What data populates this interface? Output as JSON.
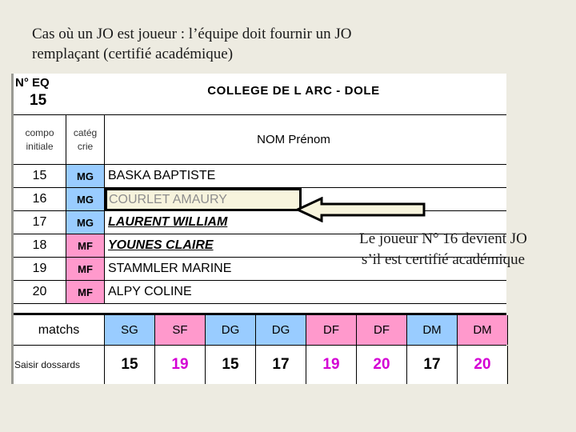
{
  "caption": {
    "line1": "Cas où un JO est joueur : l’équipe doit fournir un JO",
    "line2": "remplaçant (certifié académique)"
  },
  "sheet": {
    "eq_label": "N° EQ",
    "eq_value": "15",
    "school_name": "COLLEGE DE L ARC - DOLE",
    "subheaders": {
      "compo_l1": "compo",
      "compo_l2": "initiale",
      "categ_l1": "catég",
      "categ_l2": "crie",
      "name": "NOM Prénom"
    },
    "players": [
      {
        "num": "15",
        "categ": "MG",
        "name": "BASKA BAPTISTE",
        "style": "plain",
        "boxed": false
      },
      {
        "num": "16",
        "categ": "MG",
        "name": "COURLET AMAURY",
        "style": "faded",
        "boxed": true
      },
      {
        "num": "17",
        "categ": "MG",
        "name": "LAURENT WILLIAM",
        "style": "emph",
        "boxed": false
      },
      {
        "num": "18",
        "categ": "MF",
        "name": "YOUNES CLAIRE",
        "style": "emph",
        "boxed": false
      },
      {
        "num": "19",
        "categ": "MF",
        "name": "STAMMLER MARINE",
        "style": "plain",
        "boxed": false
      },
      {
        "num": "20",
        "categ": "MF",
        "name": "ALPY COLINE",
        "style": "plain",
        "boxed": false
      }
    ],
    "matches": {
      "row_label": "matchs",
      "dossards_label": "Saisir dossards",
      "columns": [
        {
          "type": "SG",
          "color": "blue",
          "dossard": "15",
          "dossard_color": "black"
        },
        {
          "type": "SF",
          "color": "pink",
          "dossard": "19",
          "dossard_color": "magenta"
        },
        {
          "type": "DG",
          "color": "blue",
          "dossard": "15",
          "dossard_color": "black"
        },
        {
          "type": "DG",
          "color": "blue",
          "dossard": "17",
          "dossard_color": "black"
        },
        {
          "type": "DF",
          "color": "pink",
          "dossard": "19",
          "dossard_color": "magenta"
        },
        {
          "type": "DF",
          "color": "pink",
          "dossard": "20",
          "dossard_color": "magenta"
        },
        {
          "type": "DM",
          "color": "blue",
          "dossard": "17",
          "dossard_color": "black"
        },
        {
          "type": "DM",
          "color": "pink",
          "dossard": "20",
          "dossard_color": "magenta"
        }
      ]
    }
  },
  "annotation": {
    "line1": "Le joueur N° 16 devient JO",
    "line2": "s’il est certifié académique",
    "arrow_direction": "left",
    "arrow_fill": "#f7f4dd",
    "arrow_stroke": "#000000"
  },
  "colors": {
    "page_background": "#edebe1",
    "sheet_background": "#ffffff",
    "male_category": "#99ccff",
    "female_category": "#ff99cc",
    "highlight_box": "#f7f4dd",
    "female_number": "#d400d4"
  }
}
